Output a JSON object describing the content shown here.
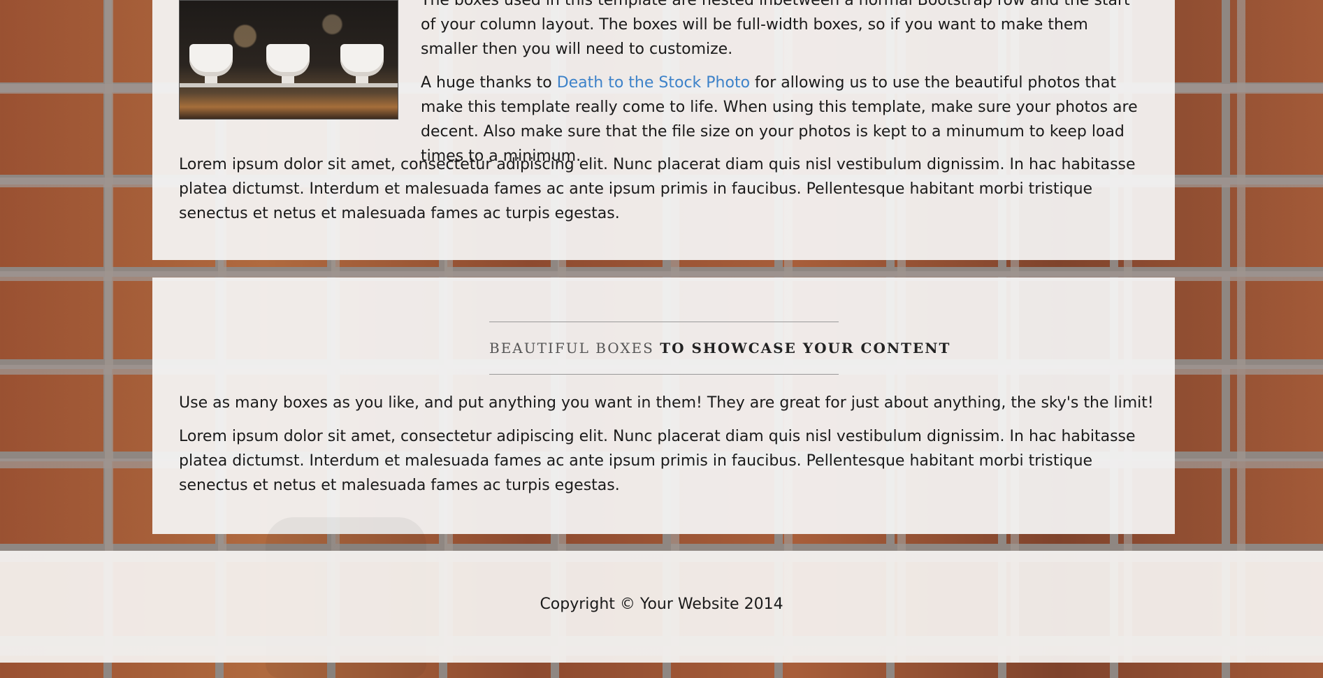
{
  "intro_box": {
    "paragraph1": "The boxes used in this template are nested inbetween a normal Bootstrap row and the start of your column layout. The boxes will be full-width boxes, so if you want to make them smaller then you will need to customize.",
    "paragraph2_before_link": "A huge thanks to ",
    "paragraph2_link": "Death to the Stock Photo",
    "paragraph2_after_link": " for allowing us to use the beautiful photos that make this template really come to life. When using this template, make sure your photos are decent. Also make sure that the file size on your photos is kept to a minumum to keep load times to a minimum.",
    "paragraph3": "Lorem ipsum dolor sit amet, consectetur adipiscing elit. Nunc placerat diam quis nisl vestibulum dignissim. In hac habitasse platea dictumst. Interdum et malesuada fames ac ante ipsum primis in faucibus. Pellentesque habitant morbi tristique senectus et netus et malesuada fames ac turpis egestas."
  },
  "showcase_box": {
    "heading_light": "Beautiful Boxes",
    "heading_strong": "to showcase your content",
    "paragraph1": "Use as many boxes as you like, and put anything you want in them! They are great for just about anything, the sky's the limit!",
    "paragraph2": "Lorem ipsum dolor sit amet, consectetur adipiscing elit. Nunc placerat diam quis nisl vestibulum dignissim. In hac habitasse platea dictumst. Interdum et malesuada fames ac ante ipsum primis in faucibus. Pellentesque habitant morbi tristique senectus et netus et malesuada fames ac turpis egestas."
  },
  "footer": {
    "copyright": "Copyright © Your Website 2014"
  },
  "colors": {
    "link": "#3d82c9",
    "box_background": "#f5f5f5",
    "text": "#1a1a1a"
  }
}
